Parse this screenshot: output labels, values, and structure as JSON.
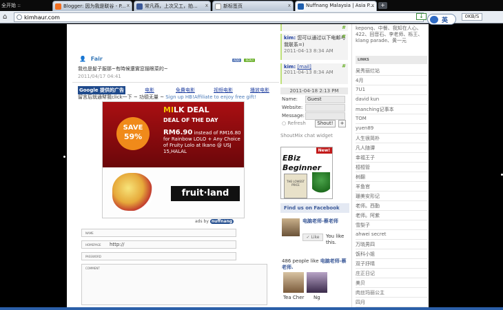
{
  "browser": {
    "first_tab": "全开始 ::",
    "tabs": [
      {
        "label": "Blogger: 因为我是联谷 - P...",
        "icon_color": "#f26f21",
        "active": false
      },
      {
        "label": "常凡燕，上次又工，拍...",
        "icon_color": "#3b5998",
        "active": false
      },
      {
        "label": "新标签页",
        "icon_color": "#e8edf3",
        "active": false
      },
      {
        "label": "Nuffnang Malaysia | Asia P...",
        "icon_color": "#1f5fae",
        "active": true
      }
    ],
    "new_tab": "+",
    "close": "x",
    "url": "kimhaur.com",
    "ime_label": "英",
    "speed": "0KB/S",
    "download_arrow": "↓"
  },
  "comment": {
    "author": "Fair",
    "tags": [
      "ADD",
      "REPLY"
    ],
    "text": "我也是髮子服那~有時候還實窓描眼菜的~",
    "date": "2011/04/17 04:41"
  },
  "ads": {
    "google": "Google 提供的广告",
    "links": [
      "电影",
      "免費电影",
      "视频电影",
      "播放电影"
    ],
    "promo_prefix": "留言后就通幇我click一下 ~",
    "promo_sign": "功德无量 ~",
    "promo_highlight": "Sign up HB!Affiliate to enjoy free gift!"
  },
  "banner": {
    "brand_m": "MI",
    "brand_rest": "LK DEAL",
    "deal_line": "DEAL OF THE DAY",
    "save_label": "SAVE",
    "save_pct": "59%",
    "price_big": "RM6.90",
    "price_text": "instead of RM16.80 for Rainbow LOLO + Any Choice of Fruity Lolo at Ikano @ USJ 15,HALAL",
    "fruitland": "fruit·land",
    "ads_by": "ads by",
    "nuffnang": "nuffnang"
  },
  "form": {
    "name_label": "NAME",
    "homepage_label": "HOMEPAGE",
    "homepage_value": "http://",
    "password_label": "PASSWORD",
    "comment_label": "COMMENT"
  },
  "shoutmix": {
    "messages": [
      {
        "name": "kim:",
        "text": "您可以通过以下电邮与我联系=)",
        "time": "2011-04-13 8:34 AM"
      },
      {
        "name": "kim:",
        "text": "[mail]",
        "time": "2011-04-13 8:34 AM"
      }
    ],
    "time_bar": "2011-04-18 2:13 PM",
    "name_label": "Name:",
    "name_value": "Guest",
    "website_label": "Website:",
    "message_label": "Message:",
    "refresh": "Refresh",
    "shout_btn": "Shout!",
    "plus_btn": "+",
    "quote": "#",
    "widget_label": "ShoutMix chat widget"
  },
  "ebiz": {
    "new": "New!",
    "t1": "EBiz",
    "t2": "Beginner",
    "book": "THE LOWEST PRICE"
  },
  "facebook": {
    "header": "Find us on Facebook",
    "page_name": "电脑老师-蔡老师",
    "like": "Like",
    "likes_text": "You like this.",
    "count_text": "486 people like",
    "count_bold": "电脑老师-蔡老师.",
    "fans": [
      "Tea Cher",
      "Ng"
    ]
  },
  "sidebar": {
    "top_text": "keponq、中餐、我知在人心、422、回音石、李老师、栎王、klang parade、黄一元",
    "links_header": "LINKS",
    "items": [
      "吴秀丽烂站",
      "4月",
      "7U1",
      "david kun",
      "manching记事本",
      "TOM",
      "yuen89",
      "人生很简朴",
      "凡人随谭",
      "幸福王子",
      "桓桓管",
      "树翻",
      "羊鱼官",
      "珊美安形记",
      "老师。西勤",
      "老师。阿紫",
      "雪梨子",
      "ahwei secret",
      "万晓男四",
      "饭科小姐",
      "双子抒晴",
      "庄正日记",
      "美贝",
      "肉丝玛丽公主",
      "四月"
    ]
  }
}
